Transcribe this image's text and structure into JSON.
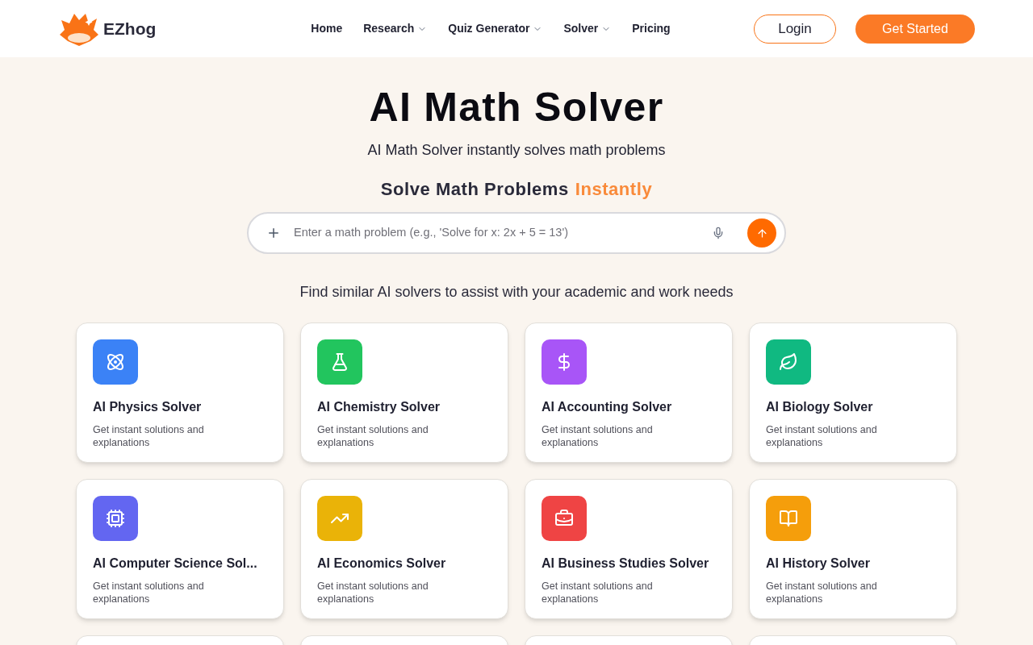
{
  "header": {
    "brand": "EZhog",
    "nav": [
      {
        "label": "Home",
        "dropdown": false
      },
      {
        "label": "Research",
        "dropdown": true
      },
      {
        "label": "Quiz Generator",
        "dropdown": true
      },
      {
        "label": "Solver",
        "dropdown": true
      },
      {
        "label": "Pricing",
        "dropdown": false
      }
    ],
    "login": "Login",
    "cta": "Get Started"
  },
  "hero": {
    "title": "AI Math Solver",
    "subtitle": "AI Math Solver instantly solves math problems",
    "tagline": "Solve Math Problems",
    "tagline_accent": "Instantly",
    "search": {
      "placeholder": "Enter a math problem (e.g., 'Solve for x: 2x + 5 = 13')"
    }
  },
  "similar": {
    "heading": "Find similar AI solvers to assist with your academic and work needs",
    "cards": [
      {
        "kind": "atom",
        "color": "#3b82f6",
        "title": "AI Physics Solver",
        "description": "Get instant solutions and explanations"
      },
      {
        "kind": "flask",
        "color": "#22c55e",
        "title": "AI Chemistry Solver",
        "description": "Get instant solutions and explanations"
      },
      {
        "kind": "dollar",
        "color": "#a855f7",
        "title": "AI Accounting Solver",
        "description": "Get instant solutions and explanations"
      },
      {
        "kind": "leaf",
        "color": "#10b981",
        "title": "AI Biology Solver",
        "description": "Get instant solutions and explanations"
      },
      {
        "kind": "chip",
        "color": "#6366f1",
        "title": "AI Computer Science Sol...",
        "description": "Get instant solutions and explanations"
      },
      {
        "kind": "trend",
        "color": "#eab308",
        "title": "AI Economics Solver",
        "description": "Get instant solutions and explanations"
      },
      {
        "kind": "briefcase",
        "color": "#ef4444",
        "title": "AI Business Studies Solver",
        "description": "Get instant solutions and explanations"
      },
      {
        "kind": "book",
        "color": "#f59e0b",
        "title": "AI History Solver",
        "description": "Get instant solutions and explanations"
      },
      {
        "kind": "hidden"
      },
      {
        "kind": "hidden"
      },
      {
        "kind": "hidden"
      },
      {
        "kind": "hidden"
      }
    ]
  }
}
